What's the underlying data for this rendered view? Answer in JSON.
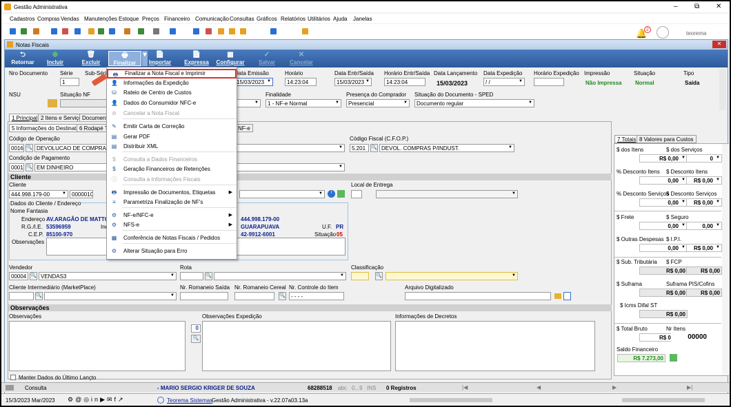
{
  "window": {
    "title": "Gestão Administrativa",
    "minimize": "–",
    "restore": "⧉",
    "close": "✕"
  },
  "menu": [
    "Cadastros",
    "Compras",
    "Vendas",
    "Manutenções",
    "Estoque",
    "Preços",
    "Financeiro",
    "Comunicação",
    "Consultas",
    "Gráficos",
    "Relatórios",
    "Utilitários",
    "Ajuda",
    "Janelas"
  ],
  "header_right": {
    "notif_count": "2",
    "user": "teorema"
  },
  "inner": {
    "title": "Notas Fiscais",
    "close": "✕"
  },
  "toolbar": {
    "retornar": "Retornar",
    "incluir": "Incluir",
    "excluir": "Excluir",
    "finalizar": "Finalizar",
    "importar": "Importar",
    "expressa": "Expressa",
    "configurar": "Configurar",
    "salvar": "Salvar",
    "cancelar": "Cancelar"
  },
  "header": {
    "nro_documento": "Nro Documento",
    "serie": "Série",
    "serie_val": "1",
    "sub_serie": "Sub-Série",
    "data_emissao": "Data Emissão",
    "data_emissao_val": "15/03/2023",
    "horario": "Horário",
    "horario_val": "14:23:04",
    "data_entr": "Data Entr/Saída",
    "data_entr_val": "15/03/2023",
    "horario_entr": "Horário Entr/Saída",
    "horario_entr_val": "14:23:04",
    "data_lanc": "Data Lançamento",
    "data_lanc_val": "15/03/2023",
    "data_exp": "Data Expedição",
    "data_exp_val": "/ /",
    "horario_exp": "Horário Expedição",
    "impressao": "Impressão",
    "impressao_val": "Não Impressa",
    "situacao": "Situação",
    "situacao_val": "Normal",
    "tipo": "Tipo",
    "tipo_val": "Saída",
    "nsu": "NSU",
    "situacao_nf": "Situação NF",
    "finalidade": "Finalidade",
    "finalidade_val": "1 - NF-e Normal",
    "presenca": "Presença do Comprador",
    "presenca_val": "Presencial",
    "sit_doc": "Situação do Documento - SPED",
    "sit_doc_val": "Documento regular"
  },
  "tabs": [
    "1 Principal",
    "2 Itens e Serviços",
    "Documentos"
  ],
  "subtabs": [
    "5 Informações do Destinatário",
    "6 Rodapé Tra",
    "NF-e"
  ],
  "principal": {
    "cod_operacao": "Código de Operação",
    "cod_operacao_num": "0016",
    "cod_operacao_val": "DEVOLUCAO DE COMPRAS",
    "cod_fiscal": "Código Fiscal (C.F.O.P.)",
    "cod_fiscal_num": "5.201",
    "cod_fiscal_val": "DEVOL. COMPRAS P/INDUST.",
    "cond_pag": "Condição de Pagamento",
    "cond_pag_num": "0001",
    "cond_pag_val": "EM DINHEIRO",
    "cliente_sec": "Cliente",
    "cliente": "Cliente",
    "cliente_cnpj": "444.998.179-00",
    "cliente_cod": "0000010",
    "local_entrega": "Local de Entrega",
    "dados_cliente": "Dados do Cliente / Endereço",
    "nome_fantasia": "Nome Fantasia",
    "endereco": "Endereço",
    "endereco_val": "AV.ARAGÃO DE MATTO",
    "rg": "R.G./I.E.",
    "rg_val": "53596959",
    "ind": "Ind",
    "cep": "C.E.P.",
    "cep_val": "85100-970",
    "cnpj2": "444.998.179-00",
    "cidade": "GUARAPUAVA",
    "uf": "U.F.",
    "uf_val": "PR",
    "fone": "42-9912-6001",
    "situacao": "Situação",
    "situacao_val": "05",
    "observacoes": "Observações",
    "vendedor": "Vendedor",
    "vendedor_num": "00004",
    "vendedor_val": "VENDAS3",
    "rota": "Rota",
    "classificacao": "Classificação",
    "cli_inter": "Cliente Intermediário (MarketPlace)",
    "rom_saida": "Nr. Romaneio Saída",
    "rom_cereal": "Nr. Romaneio Cereal",
    "ctrl_item": "Nr. Controle do Item",
    "ctrl_item_val": "- - - -",
    "arq_dig": "Arquivo Digitalizado",
    "obs_sec": "Observações",
    "obs": "Observações",
    "obs_exp": "Observações Expedição",
    "obs_exp_count": "0",
    "info_dec": "Informações de Decretos"
  },
  "totais": {
    "tab1": "7 Totais",
    "tab2": "8 Valores para Custos",
    "dos_itens": "$ dos Itens",
    "dos_itens_val": "R$ 0,00",
    "dos_serv": "$ dos Serviços",
    "dos_serv_val": "0",
    "desc_itens": "% Desconto Itens",
    "desc_itens_val": "0,00",
    "desc_itens2": "$ Desconto Itens",
    "desc_itens2_val": "R$ 0,00",
    "desc_serv": "% Desconto Serviços",
    "desc_serv_val": "0,00",
    "desc_serv2": "$ Desconto Serviços",
    "desc_serv2_val": "R$ 0,00",
    "frete": "$ Frete",
    "frete_val": "0,00",
    "seguro": "$ Seguro",
    "seguro_val": "0,00",
    "outras": "$ Outras Despesas",
    "outras_val": "0,00",
    "ipi": "$ I.P.I.",
    "ipi_val": "R$ 0,00",
    "sub_trib": "$ Sub. Tributária",
    "sub_trib_val": "R$ 0,00",
    "fcp": "$ FCP",
    "fcp_val": "R$ 0,00",
    "suframa": "$ Suframa",
    "suframa_val": "R$ 0,00",
    "suframa_pis": "Suframa PIS/Cofins",
    "suframa_pis_val": "R$ 0,00",
    "icms_difal": "$ Icms Difal ST",
    "icms_difal_val": "R$ 0,00",
    "total_bruto": "$ Total Bruto",
    "total_bruto_val": "R$ 0,00",
    "nr_itens": "Nr Itens",
    "nr_itens_val": "00000",
    "saldo": "Saldo Financeiro",
    "saldo_val": "R$ 7.273,00"
  },
  "manter": "Manter Dados do Último Lançto",
  "status": {
    "consulta": "Consulta",
    "user": "- MARIO SERGIO KRIGER DE SOUZA",
    "num": "68288518",
    "abc": "abc",
    "nums": "0...9",
    "ins": "INS",
    "registros": "0 Registros"
  },
  "footer": {
    "date": "15/3/2023 Mar/2023",
    "company": "Teorema Sistemas",
    "version": "Gestão Administrativa - v.22.07a03.13a"
  },
  "dropdown": [
    {
      "label": "Finalizar a Nota Fiscal e Imprimir",
      "icon": "printer-icon",
      "glyph": "🖶",
      "enabled": true,
      "highlight": true
    },
    {
      "label": "Informações da Expedição",
      "icon": "person-icon",
      "glyph": "👤",
      "enabled": true
    },
    {
      "label": "Rateio de Centro de Custos",
      "icon": "coins-icon",
      "glyph": "⛁",
      "enabled": true
    },
    {
      "label": "Dados do Consumidor NFC-e",
      "icon": "person-icon",
      "glyph": "👤",
      "enabled": true
    },
    {
      "label": "Cancelar a Nota Fiscal",
      "icon": "cancel-icon",
      "glyph": "⊘",
      "enabled": false
    },
    {
      "label": "Emitir Carta de Correção",
      "icon": "edit-icon",
      "glyph": "✎",
      "enabled": true
    },
    {
      "label": "Gerar PDF",
      "icon": "pdf-icon",
      "glyph": "▤",
      "enabled": true
    },
    {
      "label": "Distribuir XML",
      "icon": "xml-icon",
      "glyph": "▤",
      "enabled": true
    },
    {
      "label": "Consulta a Dados Financeiros",
      "icon": "money-icon",
      "glyph": "$",
      "enabled": false
    },
    {
      "label": "Geração Financeiros de Retenções",
      "icon": "money-icon",
      "glyph": "$",
      "enabled": true
    },
    {
      "label": "Consulta a Informações Fiscais",
      "icon": "info-icon",
      "glyph": "ⓘ",
      "enabled": false
    },
    {
      "label": "Impressão de Documentos, Etiquetas",
      "icon": "printer-icon",
      "glyph": "🖶",
      "enabled": true,
      "sub": true
    },
    {
      "label": "Parametriza Finalização de NF's",
      "icon": "settings-icon",
      "glyph": "≡",
      "enabled": true
    },
    {
      "label": "NF-e/NFC-e",
      "icon": "nfe-icon",
      "glyph": "⚙",
      "enabled": true,
      "sub": true
    },
    {
      "label": "NFS-e",
      "icon": "nfse-icon",
      "glyph": "⚙",
      "enabled": true,
      "sub": true
    },
    {
      "label": "Conferência de Notas Fiscais / Pedidos",
      "icon": "check-icon",
      "glyph": "▦",
      "enabled": true
    },
    {
      "label": "Alterar Situação para Erro",
      "icon": "error-icon",
      "glyph": "⚙",
      "enabled": true
    }
  ]
}
